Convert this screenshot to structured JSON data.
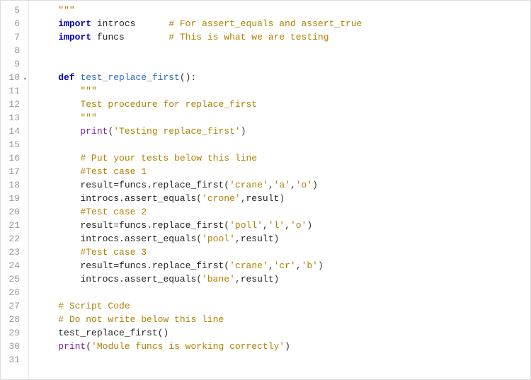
{
  "editor": {
    "first_line": 5,
    "lines": [
      {
        "n": 5,
        "fold": null,
        "tokens": [
          [
            "    ",
            "ws"
          ],
          [
            "\"\"\"",
            "docstr"
          ]
        ]
      },
      {
        "n": 6,
        "fold": null,
        "tokens": [
          [
            "    ",
            "ws"
          ],
          [
            "import",
            "keyword"
          ],
          [
            " ",
            "ws"
          ],
          [
            "introcs",
            "ident"
          ],
          [
            "      ",
            "ws"
          ],
          [
            "# For assert_equals and assert_true",
            "comment"
          ]
        ]
      },
      {
        "n": 7,
        "fold": null,
        "tokens": [
          [
            "    ",
            "ws"
          ],
          [
            "import",
            "keyword"
          ],
          [
            " ",
            "ws"
          ],
          [
            "funcs",
            "ident"
          ],
          [
            "        ",
            "ws"
          ],
          [
            "# This is what we are testing",
            "comment"
          ]
        ]
      },
      {
        "n": 8,
        "fold": null,
        "tokens": []
      },
      {
        "n": 9,
        "fold": null,
        "tokens": []
      },
      {
        "n": 10,
        "fold": "down",
        "tokens": [
          [
            "    ",
            "ws"
          ],
          [
            "def",
            "keyword"
          ],
          [
            " ",
            "ws"
          ],
          [
            "test_replace_first",
            "func"
          ],
          [
            "():",
            "punct"
          ]
        ]
      },
      {
        "n": 11,
        "fold": null,
        "tokens": [
          [
            "        ",
            "ws"
          ],
          [
            "\"\"\"",
            "docstr"
          ]
        ]
      },
      {
        "n": 12,
        "fold": null,
        "tokens": [
          [
            "        ",
            "ws"
          ],
          [
            "Test procedure for replace_first",
            "docstr"
          ]
        ]
      },
      {
        "n": 13,
        "fold": null,
        "tokens": [
          [
            "        ",
            "ws"
          ],
          [
            "\"\"\"",
            "docstr"
          ]
        ]
      },
      {
        "n": 14,
        "fold": null,
        "tokens": [
          [
            "        ",
            "ws"
          ],
          [
            "print",
            "builtin"
          ],
          [
            "(",
            "punct"
          ],
          [
            "'Testing replace_first'",
            "str"
          ],
          [
            ")",
            "punct"
          ]
        ]
      },
      {
        "n": 15,
        "fold": null,
        "tokens": []
      },
      {
        "n": 16,
        "fold": null,
        "tokens": [
          [
            "        ",
            "ws"
          ],
          [
            "# Put your tests below this line",
            "comment"
          ]
        ]
      },
      {
        "n": 17,
        "fold": null,
        "tokens": [
          [
            "        ",
            "ws"
          ],
          [
            "#Test case 1",
            "comment"
          ]
        ]
      },
      {
        "n": 18,
        "fold": null,
        "tokens": [
          [
            "        ",
            "ws"
          ],
          [
            "result",
            "ident"
          ],
          [
            "=",
            "punct"
          ],
          [
            "funcs",
            "ident"
          ],
          [
            ".",
            "punct"
          ],
          [
            "replace_first",
            "ident"
          ],
          [
            "(",
            "punct"
          ],
          [
            "'crane'",
            "str"
          ],
          [
            ",",
            "punct"
          ],
          [
            "'a'",
            "str"
          ],
          [
            ",",
            "punct"
          ],
          [
            "'o'",
            "str"
          ],
          [
            ")",
            "punct"
          ]
        ]
      },
      {
        "n": 19,
        "fold": null,
        "tokens": [
          [
            "        ",
            "ws"
          ],
          [
            "introcs",
            "ident"
          ],
          [
            ".",
            "punct"
          ],
          [
            "assert_equals",
            "ident"
          ],
          [
            "(",
            "punct"
          ],
          [
            "'crone'",
            "str"
          ],
          [
            ",",
            "punct"
          ],
          [
            "result",
            "ident"
          ],
          [
            ")",
            "punct"
          ]
        ]
      },
      {
        "n": 20,
        "fold": null,
        "tokens": [
          [
            "        ",
            "ws"
          ],
          [
            "#Test case 2",
            "comment"
          ]
        ]
      },
      {
        "n": 21,
        "fold": null,
        "tokens": [
          [
            "        ",
            "ws"
          ],
          [
            "result",
            "ident"
          ],
          [
            "=",
            "punct"
          ],
          [
            "funcs",
            "ident"
          ],
          [
            ".",
            "punct"
          ],
          [
            "replace_first",
            "ident"
          ],
          [
            "(",
            "punct"
          ],
          [
            "'poll'",
            "str"
          ],
          [
            ",",
            "punct"
          ],
          [
            "'l'",
            "str"
          ],
          [
            ",",
            "punct"
          ],
          [
            "'o'",
            "str"
          ],
          [
            ")",
            "punct"
          ]
        ]
      },
      {
        "n": 22,
        "fold": null,
        "tokens": [
          [
            "        ",
            "ws"
          ],
          [
            "introcs",
            "ident"
          ],
          [
            ".",
            "punct"
          ],
          [
            "assert_equals",
            "ident"
          ],
          [
            "(",
            "punct"
          ],
          [
            "'pool'",
            "str"
          ],
          [
            ",",
            "punct"
          ],
          [
            "result",
            "ident"
          ],
          [
            ")",
            "punct"
          ]
        ]
      },
      {
        "n": 23,
        "fold": null,
        "tokens": [
          [
            "        ",
            "ws"
          ],
          [
            "#Test case 3",
            "comment"
          ]
        ]
      },
      {
        "n": 24,
        "fold": null,
        "tokens": [
          [
            "        ",
            "ws"
          ],
          [
            "result",
            "ident"
          ],
          [
            "=",
            "punct"
          ],
          [
            "funcs",
            "ident"
          ],
          [
            ".",
            "punct"
          ],
          [
            "replace_first",
            "ident"
          ],
          [
            "(",
            "punct"
          ],
          [
            "'crane'",
            "str"
          ],
          [
            ",",
            "punct"
          ],
          [
            "'cr'",
            "str"
          ],
          [
            ",",
            "punct"
          ],
          [
            "'b'",
            "str"
          ],
          [
            ")",
            "punct"
          ]
        ]
      },
      {
        "n": 25,
        "fold": null,
        "tokens": [
          [
            "        ",
            "ws"
          ],
          [
            "introcs",
            "ident"
          ],
          [
            ".",
            "punct"
          ],
          [
            "assert_equals",
            "ident"
          ],
          [
            "(",
            "punct"
          ],
          [
            "'bane'",
            "str"
          ],
          [
            ",",
            "punct"
          ],
          [
            "result",
            "ident"
          ],
          [
            ")",
            "punct"
          ]
        ]
      },
      {
        "n": 26,
        "fold": null,
        "tokens": []
      },
      {
        "n": 27,
        "fold": null,
        "tokens": [
          [
            "    ",
            "ws"
          ],
          [
            "# Script Code",
            "comment"
          ]
        ]
      },
      {
        "n": 28,
        "fold": null,
        "tokens": [
          [
            "    ",
            "ws"
          ],
          [
            "# Do not write below this line",
            "comment"
          ]
        ]
      },
      {
        "n": 29,
        "fold": null,
        "tokens": [
          [
            "    ",
            "ws"
          ],
          [
            "test_replace_first",
            "ident"
          ],
          [
            "()",
            "punct"
          ]
        ]
      },
      {
        "n": 30,
        "fold": null,
        "tokens": [
          [
            "    ",
            "ws"
          ],
          [
            "print",
            "builtin"
          ],
          [
            "(",
            "punct"
          ],
          [
            "'Module funcs is working correctly'",
            "str"
          ],
          [
            ")",
            "punct"
          ]
        ]
      },
      {
        "n": 31,
        "fold": null,
        "tokens": []
      }
    ]
  }
}
